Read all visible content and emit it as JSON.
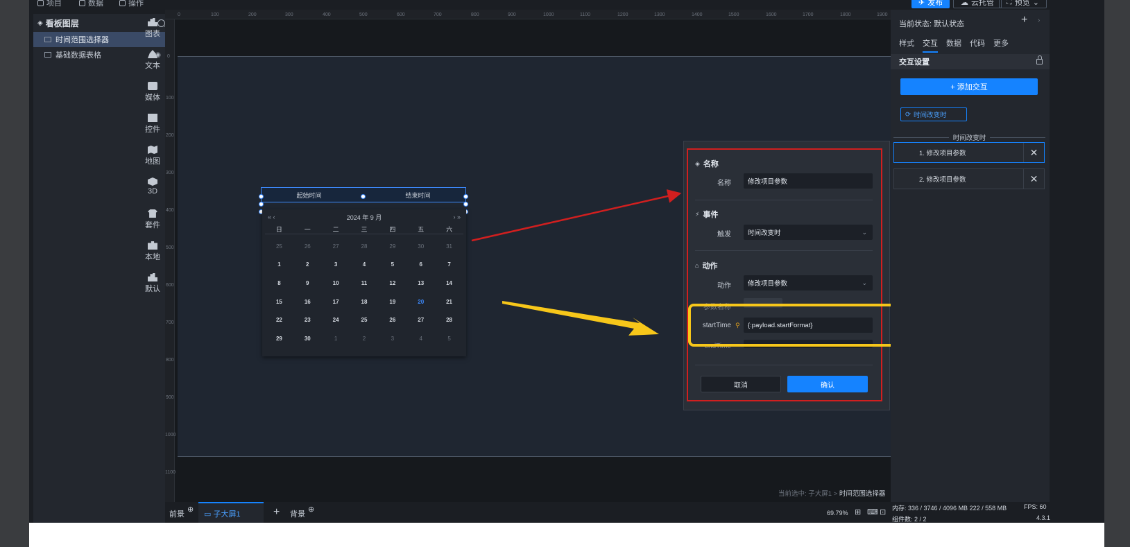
{
  "top_menu": {
    "items": [
      "项目",
      "数据",
      "操作"
    ],
    "buttons": [
      "发布",
      "云托管",
      "预览"
    ]
  },
  "layers": {
    "title": "看板图层",
    "items": [
      {
        "label": "时间范围选择器",
        "selected": true
      },
      {
        "label": "基础数据表格",
        "selected": false
      }
    ]
  },
  "tools": [
    "图表",
    "文本",
    "媒体",
    "控件",
    "地图",
    "3D",
    "套件",
    "本地",
    "默认"
  ],
  "ruler": {
    "top": [
      "0",
      "100",
      "200",
      "300",
      "400",
      "500",
      "600",
      "700",
      "800",
      "900",
      "1000",
      "1100",
      "1200",
      "1300",
      "1400",
      "1500",
      "1600",
      "1700",
      "1800",
      "1900"
    ],
    "left": [
      "0",
      "100",
      "200",
      "300",
      "400",
      "500",
      "600",
      "700",
      "800",
      "900",
      "1000",
      "1100"
    ]
  },
  "date_picker": {
    "start_placeholder": "起始时间",
    "separator": "-",
    "end_placeholder": "结束时间",
    "month_title": "2024 年 9 月",
    "nav_prev": "« ‹",
    "nav_next": "› »",
    "weekdays": [
      "日",
      "一",
      "二",
      "三",
      "四",
      "五",
      "六"
    ],
    "days": [
      "25",
      "26",
      "27",
      "28",
      "29",
      "30",
      "31",
      "1",
      "2",
      "3",
      "4",
      "5",
      "6",
      "7",
      "8",
      "9",
      "10",
      "11",
      "12",
      "13",
      "14",
      "15",
      "16",
      "17",
      "18",
      "19",
      "20",
      "21",
      "22",
      "23",
      "24",
      "25",
      "26",
      "27",
      "28",
      "29",
      "30",
      "1",
      "2",
      "3",
      "4",
      "5"
    ],
    "today_index": 26
  },
  "dialog": {
    "name_section": "名称",
    "name_label": "名称",
    "name_value": "修改项目参数",
    "event_section": "事件",
    "trigger_label": "触发",
    "trigger_value": "时间改变时",
    "action_section": "动作",
    "action_label": "动作",
    "action_value": "修改项目参数",
    "param_label": "参数名称",
    "start_label": "startTime",
    "start_value": "{:payload.startFormat}",
    "end_label": "endTime",
    "cancel": "取消",
    "confirm": "确认"
  },
  "right_panel": {
    "state": "当前状态:  默认状态",
    "plus": "+",
    "arrow": "›",
    "tabs": [
      "样式",
      "交互",
      "数据",
      "代码",
      "更多"
    ],
    "active_tab": "交互",
    "section_title": "交互设置",
    "add_button": "+ 添加交互",
    "event_tag": "时间改变时",
    "divider": "时间改变时",
    "interactions": [
      "1. 修改项目参数",
      "2. 修改项目参数"
    ]
  },
  "bottom": {
    "tab_front": "前景",
    "tab_screen": "子大屏1",
    "tab_back": "背景",
    "zoom": "69.79%",
    "selected_prefix": "当前选中:  子大屏1 >",
    "selected_item": "时间范围选择器"
  },
  "status": {
    "memory": "内存:  336 / 3746 / 4096 MB  222 / 558 MB",
    "fps": "FPS:  60",
    "components": "组件数: 2 / 2",
    "version": "4.3.1"
  },
  "colors": {
    "accent": "#1583ff",
    "highlight_red": "#d11f1f",
    "highlight_yellow": "#f7c71a"
  }
}
